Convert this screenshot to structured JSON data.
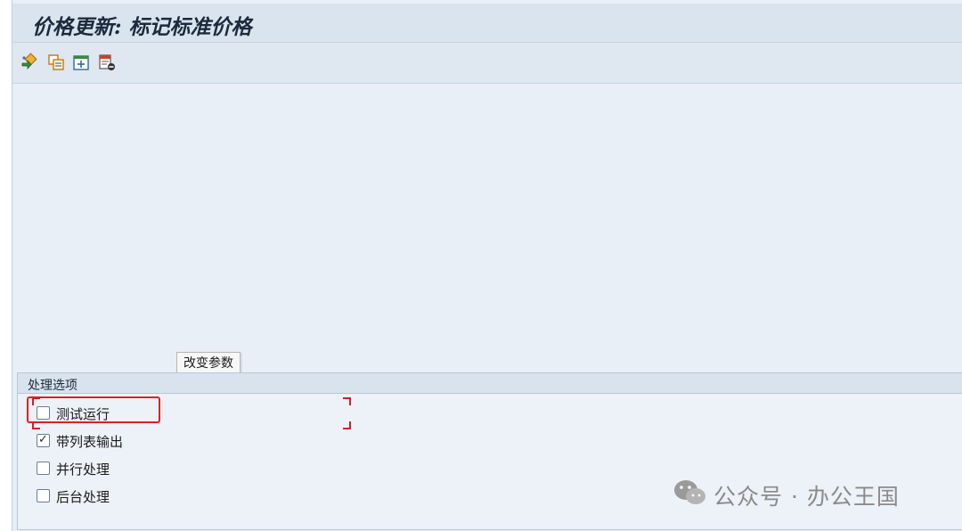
{
  "window": {
    "title": "价格更新: 标记标准价格"
  },
  "toolbar": {
    "buttons": [
      {
        "name": "execute-icon"
      },
      {
        "name": "copy-variant-icon"
      },
      {
        "name": "get-variant-icon"
      },
      {
        "name": "delete-variant-icon"
      }
    ]
  },
  "tooltip": {
    "text": "改变参数"
  },
  "processing_options": {
    "title": "处理选项",
    "options": [
      {
        "label": "测试运行",
        "checked": false
      },
      {
        "label": "带列表输出",
        "checked": true
      },
      {
        "label": "并行处理",
        "checked": false
      },
      {
        "label": "后台处理",
        "checked": false
      }
    ]
  },
  "watermark": {
    "text": "公众号 · 办公王国",
    "icon": "wechat-icon"
  },
  "colors": {
    "highlight": "#e02020",
    "title_bar": "#dae4ef",
    "background": "#e9eff7"
  }
}
